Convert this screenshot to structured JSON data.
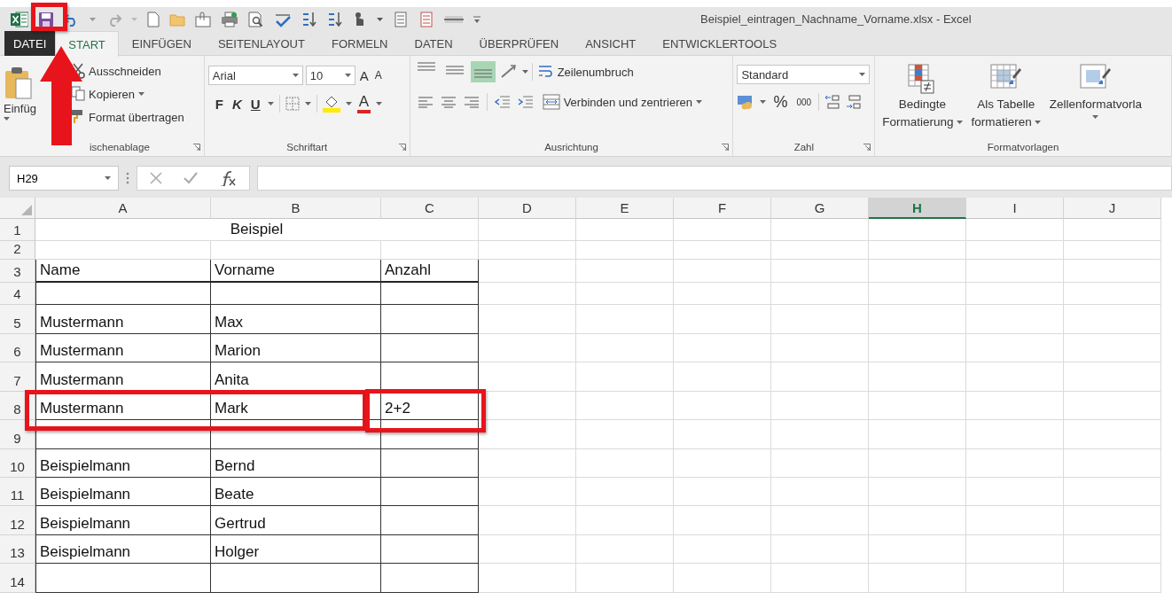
{
  "window": {
    "title": "Beispiel_eintragen_Nachname_Vorname.xlsx - Excel"
  },
  "tabs": [
    {
      "label": "DATEI",
      "kind": "file",
      "selected": false
    },
    {
      "label": "START",
      "kind": "tab",
      "selected": true
    },
    {
      "label": "EINFÜGEN",
      "kind": "tab",
      "selected": false
    },
    {
      "label": "SEITENLAYOUT",
      "kind": "tab",
      "selected": false
    },
    {
      "label": "FORMELN",
      "kind": "tab",
      "selected": false
    },
    {
      "label": "DATEN",
      "kind": "tab",
      "selected": false
    },
    {
      "label": "ÜBERPRÜFEN",
      "kind": "tab",
      "selected": false
    },
    {
      "label": "ANSICHT",
      "kind": "tab",
      "selected": false
    },
    {
      "label": "ENTWICKLERTOOLS",
      "kind": "tab",
      "selected": false
    }
  ],
  "ribbon": {
    "clipboard": {
      "label": "ischenablage",
      "paste": "Einfüg",
      "commands": [
        {
          "label": "Ausschneiden",
          "dropdown": false
        },
        {
          "label": "Kopieren",
          "dropdown": true
        },
        {
          "label": "Format übertragen",
          "dropdown": false
        }
      ]
    },
    "font": {
      "label": "Schriftart",
      "font_name": "Arial",
      "font_size": "10",
      "grow": "A",
      "shrink": "A",
      "bold": "F",
      "italic": "K",
      "underline": "U",
      "font_color": "A"
    },
    "alignment": {
      "label": "Ausrichtung",
      "wrap_text": "Zeilenumbruch",
      "merge_center": "Verbinden und zentrieren",
      "vertical": [
        {
          "selected": false
        },
        {
          "selected": false
        },
        {
          "selected": true
        }
      ]
    },
    "number": {
      "label": "Zahl",
      "format": "Standard",
      "percent": "%",
      "thousands": "000"
    },
    "styles": {
      "label": "Formatvorlagen",
      "buttons": [
        {
          "lines": [
            "Bedingte",
            "Formatierung"
          ],
          "kind": "conditional"
        },
        {
          "lines": [
            "Als Tabelle",
            "formatieren"
          ],
          "kind": "table"
        },
        {
          "lines": [
            "Zellenformatvorla"
          ],
          "kind": "cell"
        }
      ]
    }
  },
  "formula_bar": {
    "name_box": "H29"
  },
  "sheet": {
    "columns": [
      {
        "label": "A",
        "selected": false
      },
      {
        "label": "B",
        "selected": false
      },
      {
        "label": "C",
        "selected": false
      },
      {
        "label": "D",
        "selected": false
      },
      {
        "label": "E",
        "selected": false
      },
      {
        "label": "F",
        "selected": false
      },
      {
        "label": "G",
        "selected": false
      },
      {
        "label": "H",
        "selected": true
      },
      {
        "label": "I",
        "selected": false
      },
      {
        "label": "J",
        "selected": false
      }
    ],
    "rows": [
      {
        "number": "1",
        "kind": "title",
        "cells": [
          "Beispiel"
        ]
      },
      {
        "number": "2",
        "kind": "blank"
      },
      {
        "number": "3",
        "kind": "header",
        "cells": [
          "Name",
          "Vorname",
          "Anzahl"
        ]
      },
      {
        "number": "4",
        "kind": "data"
      },
      {
        "number": "5",
        "kind": "data",
        "cells": [
          "Mustermann",
          "Max"
        ]
      },
      {
        "number": "6",
        "kind": "data",
        "cells": [
          "Mustermann",
          "Marion"
        ]
      },
      {
        "number": "7",
        "kind": "data",
        "cells": [
          "Mustermann",
          "Anita"
        ]
      },
      {
        "number": "8",
        "kind": "data",
        "cells": [
          "Mustermann",
          "Mark",
          "2+2"
        ]
      },
      {
        "number": "9",
        "kind": "data"
      },
      {
        "number": "10",
        "kind": "data",
        "cells": [
          "Beispielmann",
          "Bernd"
        ]
      },
      {
        "number": "11",
        "kind": "data",
        "cells": [
          "Beispielmann",
          "Beate"
        ]
      },
      {
        "number": "12",
        "kind": "data",
        "cells": [
          "Beispielmann",
          "Gertrud"
        ]
      },
      {
        "number": "13",
        "kind": "data",
        "cells": [
          "Beispielmann",
          "Holger"
        ]
      },
      {
        "number": "14",
        "kind": "data"
      }
    ]
  }
}
